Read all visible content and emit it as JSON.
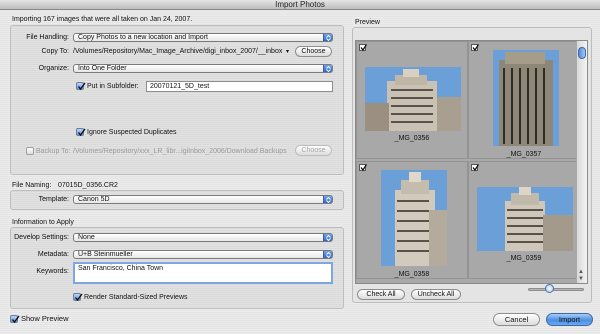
{
  "window": {
    "title": "Import Photos"
  },
  "left": {
    "group_title": "Importing 167 images that were all taken on Jan 24, 2007.",
    "file_handling": {
      "label": "File Handling:",
      "value": "Copy Photos to a new location and Import"
    },
    "copy_to": {
      "label": "Copy To:",
      "path": "/Volumes/Repository/Mac_Image_Archive/digi_inbox_2007/__inbox",
      "button": "Choose"
    },
    "organize": {
      "label": "Organize:",
      "value": "Into One Folder"
    },
    "subfolder": {
      "label": "Put in Subfolder:",
      "value": "20070121_5D_test",
      "checked": true
    },
    "ignore_duplicates": {
      "label": "Ignore Suspected Duplicates",
      "checked": true
    },
    "backup": {
      "label": "Backup To:",
      "path": "/Volumes/Repository/xxx_LR_libr...igiInbox_2006/Download Backups",
      "button": "Choose",
      "checked": false
    }
  },
  "naming": {
    "label": "File Naming:",
    "example": "07015D_0356.CR2",
    "template_label": "Template:",
    "template_value": "Canon 5D"
  },
  "apply": {
    "group_title": "Information to Apply",
    "develop": {
      "label": "Develop Settings:",
      "value": "None"
    },
    "metadata": {
      "label": "Metadata:",
      "value": "U+B Steinmueller"
    },
    "keywords": {
      "label": "Keywords:",
      "value": "San Francisco, China Town"
    },
    "render_previews": {
      "label": "Render Standard-Sized Previews",
      "checked": true
    }
  },
  "preview": {
    "title": "Preview",
    "thumbnails": [
      {
        "name": "_MG_0356",
        "checked": true
      },
      {
        "name": "_MG_0357",
        "checked": true
      },
      {
        "name": "_MG_0358",
        "checked": true
      },
      {
        "name": "_MG_0359",
        "checked": true
      }
    ],
    "check_all": "Check All",
    "uncheck_all": "Uncheck All"
  },
  "footer": {
    "show_preview": "Show Preview",
    "cancel": "Cancel",
    "import": "Import"
  },
  "colors": {
    "accent": "#4c8fe3",
    "sky": "#6b9fd8"
  }
}
